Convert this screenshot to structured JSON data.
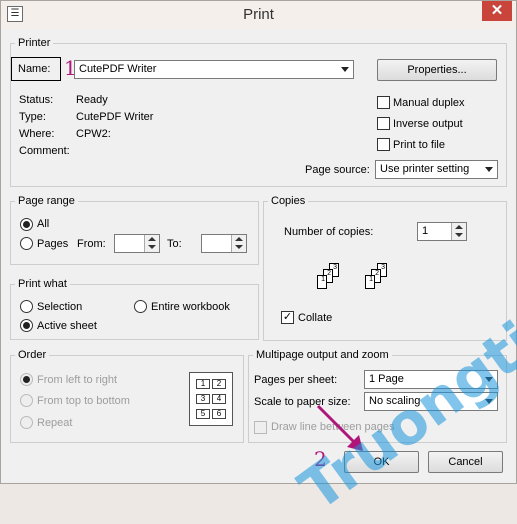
{
  "window": {
    "title": "Print",
    "close_glyph": "✕",
    "app_glyph": "☰"
  },
  "printer": {
    "legend": "Printer",
    "name_label": "Name:",
    "name_value": "CutePDF Writer",
    "properties_label": "Properties...",
    "status_label": "Status:",
    "status_value": "Ready",
    "type_label": "Type:",
    "type_value": "CutePDF Writer",
    "where_label": "Where:",
    "where_value": "CPW2:",
    "comment_label": "Comment:",
    "manual_duplex_label": "Manual duplex",
    "inverse_output_label": "Inverse output",
    "print_to_file_label": "Print to file",
    "page_source_label": "Page source:",
    "page_source_value": "Use printer setting"
  },
  "page_range": {
    "legend": "Page range",
    "all_label": "All",
    "pages_label": "Pages",
    "from_label": "From:",
    "to_label": "To:",
    "from_value": "",
    "to_value": ""
  },
  "copies": {
    "legend": "Copies",
    "number_label": "Number of copies:",
    "number_value": "1",
    "collate_label": "Collate",
    "collate_checked": "✓"
  },
  "print_what": {
    "legend": "Print what",
    "selection_label": "Selection",
    "entire_workbook_label": "Entire workbook",
    "active_sheet_label": "Active sheet"
  },
  "order": {
    "legend": "Order",
    "left_to_right_label": "From left to right",
    "top_to_bottom_label": "From top to bottom",
    "repeat_label": "Repeat",
    "preview_cells": [
      "1",
      "2",
      "3",
      "4",
      "5",
      "6"
    ]
  },
  "multipage": {
    "legend": "Multipage output and zoom",
    "pages_per_sheet_label": "Pages per sheet:",
    "pages_per_sheet_value": "1 Page",
    "scale_label": "Scale to paper size:",
    "scale_value": "No scaling",
    "draw_line_label": "Draw line between pages"
  },
  "buttons": {
    "ok_label": "OK",
    "cancel_label": "Cancel"
  },
  "annotations": {
    "marker_1": "1",
    "marker_2": "2"
  },
  "watermark": {
    "text": "Truongtin.top",
    "color": "#1a96dc"
  },
  "colors": {
    "annotation": "#b0167a",
    "close_button": "#c9443a"
  }
}
